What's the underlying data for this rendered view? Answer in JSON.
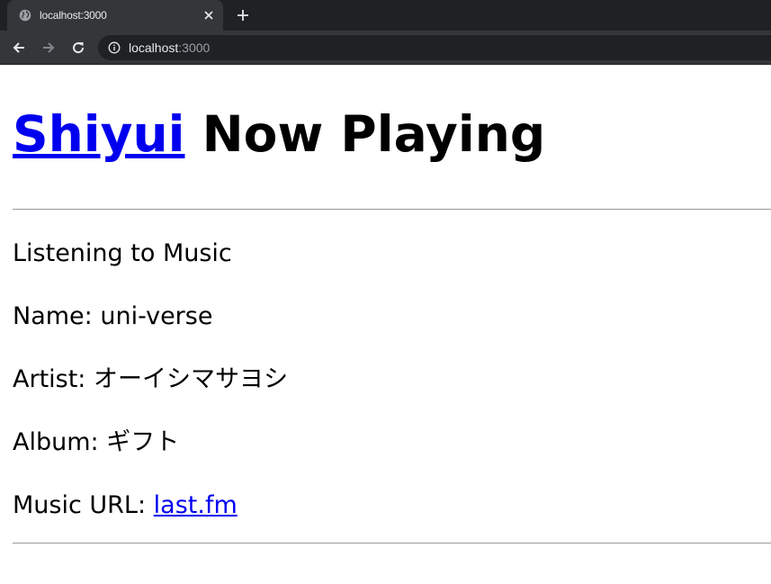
{
  "browser": {
    "tab_title": "localhost:3000",
    "url_host": "localhost",
    "url_port": ":3000",
    "favicon_icon": "globe-icon",
    "close_icon": "close-icon",
    "new_tab_icon": "plus-icon"
  },
  "page": {
    "title_link": "Shiyui",
    "title_rest": " Now Playing",
    "status": "Listening to Music",
    "name_label": "Name: ",
    "name_value": "uni-verse",
    "artist_label": "Artist: ",
    "artist_value": "オーイシマサヨシ",
    "album_label": "Album: ",
    "album_value": "ギフト",
    "url_label": "Music URL: ",
    "url_link": "last.fm"
  },
  "colors": {
    "chrome_dark": "#202124",
    "chrome_tab": "#35363a",
    "link": "#0000ee"
  }
}
